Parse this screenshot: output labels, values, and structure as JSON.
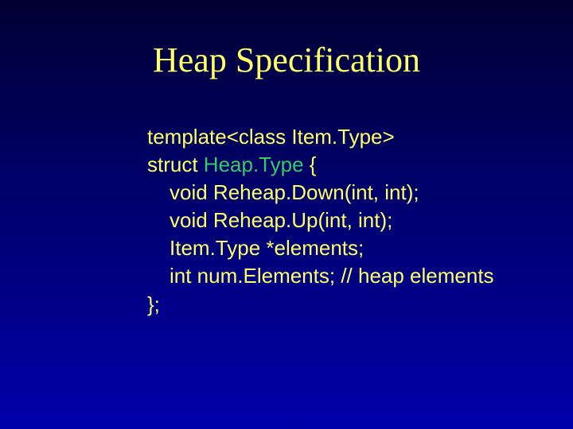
{
  "title": "Heap Specification",
  "code": {
    "l1": "template<class Item.Type>",
    "l2a": "struct ",
    "l2b": "Heap.Type",
    "l2c": " {",
    "l3": "void Reheap.Down(int, int);",
    "l4": "void Reheap.Up(int, int);",
    "l5": "Item.Type *elements;",
    "l6": "int num.Elements; // heap elements",
    "l7": "};"
  }
}
